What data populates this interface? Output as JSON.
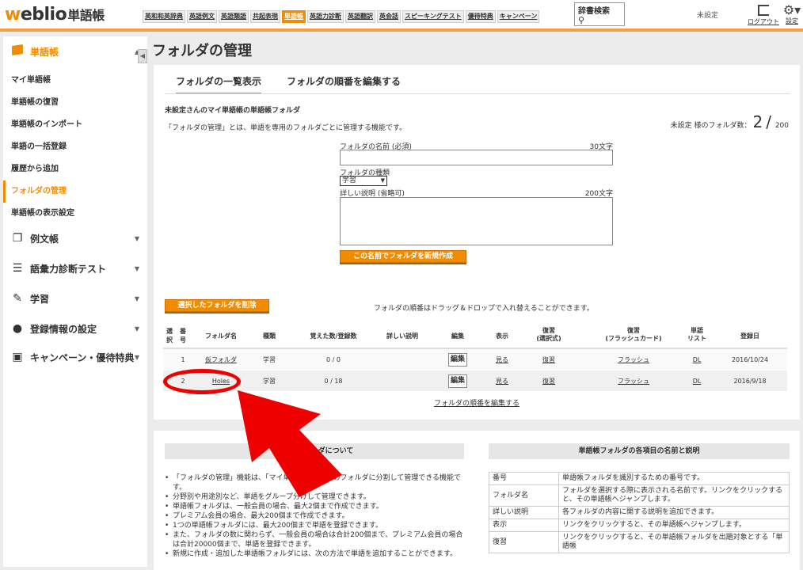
{
  "header": {
    "logo_prefix": "w",
    "logo_main": "eblio",
    "logo_sub": "単語帳",
    "nav": [
      "英和和英辞典",
      "英語例文",
      "英語類語",
      "共起表現",
      "単語帳",
      "英語力診断",
      "英語翻訳",
      "英会話",
      "スピーキングテスト",
      "優待特典",
      "キャンペーン"
    ],
    "active_nav": 4,
    "dict_search_label": "辞書検索",
    "status": "未設定",
    "logout_label": "ログアウト",
    "settings_label": "設定"
  },
  "sidebar": {
    "top": "単語帳",
    "subitems": [
      "マイ単語帳",
      "単語帳の復習",
      "単語帳のインポート",
      "単語の一括登録",
      "履歴から追加",
      "フォルダの管理",
      "単語帳の表示設定"
    ],
    "active_sub": 5,
    "sections": [
      "例文帳",
      "語彙力診断テスト",
      "学習",
      "登録情報の設定",
      "キャンペーン・優待特典"
    ]
  },
  "main": {
    "title": "フォルダの管理",
    "tabs": [
      "フォルダの一覧表示",
      "フォルダの順番を編集する"
    ],
    "section_title": "未設定さんのマイ単語帳の単語帳フォルダ",
    "section_desc": "「フォルダの管理」とは、単語を専用のフォルダごとに管理する機能です。",
    "count_prefix": "未設定 様のフォルダ数：",
    "count_value": "2",
    "count_sep": "/",
    "count_max": "200",
    "form": {
      "name_label": "フォルダの名前 (必須)",
      "name_limit": "30文字",
      "type_label": "フォルダの種類",
      "type_value": "学習",
      "desc_label": "詳しい説明 (省略可)",
      "desc_limit": "200文字",
      "create_button": "この名前でフォルダを新規作成"
    },
    "delete_button": "選択したフォルダを削除",
    "drag_note": "フォルダの順番はドラッグ＆ドロップで入れ替えることができます。",
    "table": {
      "headers": [
        "選択",
        "番号",
        "フォルダ名",
        "種類",
        "覚えた数/登録数",
        "詳しい説明",
        "編集",
        "表示",
        "復習\n(選択式)",
        "復習\n(フラッシュカード)",
        "単語\nリスト",
        "登録日"
      ],
      "rows": [
        {
          "num": "1",
          "name": "仮フォルダ",
          "type": "学習",
          "count": "0 / 0",
          "edit": "編集",
          "view": "見る",
          "review1": "復習",
          "review2": "フラッシュ",
          "list": "DL",
          "date": "2016/10/24"
        },
        {
          "num": "2",
          "name": "Holes",
          "type": "学習",
          "count": "0 / 18",
          "edit": "編集",
          "view": "見る",
          "review1": "復習",
          "review2": "フラッシュ",
          "list": "DL",
          "date": "2016/9/18"
        }
      ]
    },
    "reorder_link": "フォルダの順番を編集する"
  },
  "bottom": {
    "left_title": "単語帳フォルダについて",
    "left_items": [
      "「フォルダの管理」機能は、「マイ単語帳」を複数のフォルダに分割して管理できる機能です。",
      "分野別や用途別など、単語をグループ分けして管理できます。",
      "単語帳フォルダは、一般会員の場合、最大2個まで作成できます。",
      "プレミアム会員の場合、最大200個まで作成できます。",
      "1つの単語帳フォルダには、最大200個まで単語を登録できます。",
      "また、フォルダの数に関わらず、一般会員の場合は合計200個まで、プレミアム会員の場合は合計20000個まで、単語を登録できます。",
      "新規に作成・追加した単語帳フォルダには、次の方法で単語を追加することができます。"
    ],
    "right_title": "単語帳フォルダの各項目の名前と説明",
    "definitions": [
      {
        "k": "番号",
        "v": "単語帳フォルダを識別するための番号です。"
      },
      {
        "k": "フォルダ名",
        "v": "フォルダを選択する際に表示される名前です。リンクをクリックすると、その単語帳へジャンプします。"
      },
      {
        "k": "詳しい説明",
        "v": "各フォルダの内容に関する説明を追加できます。"
      },
      {
        "k": "表示",
        "v": "リンクをクリックすると、その単語帳へジャンプします。"
      },
      {
        "k": "復習",
        "v": "リンクをクリックすると、その単語帳フォルダを出題対象とする「単語帳"
      }
    ]
  }
}
